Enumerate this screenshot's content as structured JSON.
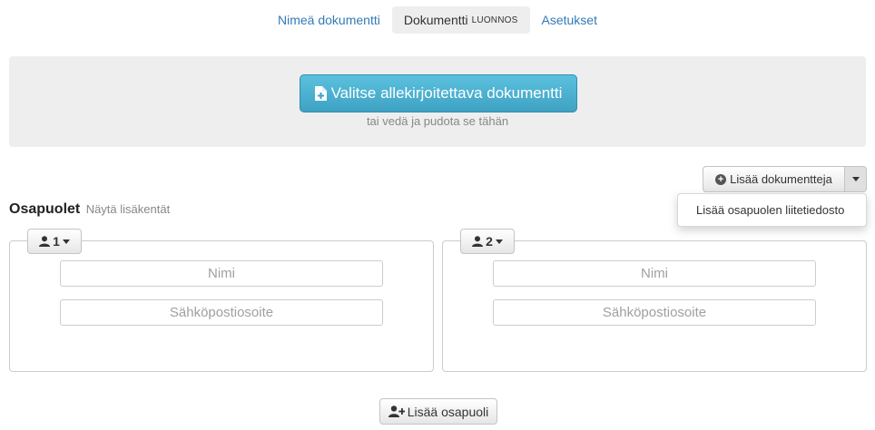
{
  "tabs": [
    {
      "label": "Nimeä dokumentti",
      "sub": ""
    },
    {
      "label": "Dokumentti",
      "sub": "LUONNOS"
    },
    {
      "label": "Asetukset",
      "sub": ""
    }
  ],
  "upload": {
    "button_label": "Valitse allekirjoitettava dokumentti",
    "hint": "tai vedä ja pudota se tähän"
  },
  "add_documents": {
    "label": "Lisää dokumentteja",
    "menu": [
      "Lisää osapuolen liitetiedosto"
    ]
  },
  "parties": {
    "title": "Osapuolet",
    "extra_fields_link": "Näytä lisäkentät",
    "items": [
      {
        "number": "1",
        "name_placeholder": "Nimi",
        "email_placeholder": "Sähköpostiosoite"
      },
      {
        "number": "2",
        "name_placeholder": "Nimi",
        "email_placeholder": "Sähköpostiosoite"
      }
    ],
    "add_party_label": "Lisää osapuoli"
  },
  "colors": {
    "primary_button": "#4bb1d3",
    "link": "#337ab7"
  }
}
